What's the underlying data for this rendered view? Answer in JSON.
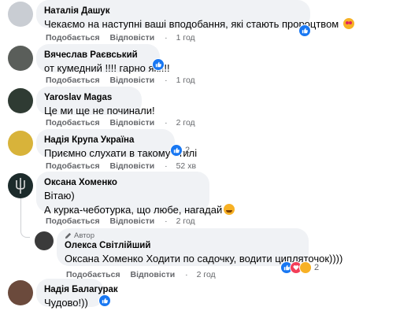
{
  "actions": {
    "like": "Подобається",
    "reply": "Відповісти"
  },
  "comments": [
    {
      "author": "Наталія Дашук",
      "text": "Чекаємо на наступні ваші вподобання, які стають пророцтвом",
      "time": "1 год",
      "avatar_color": "#c9cdd3",
      "avatar_icon": "avatar-icon"
    },
    {
      "author": "Вячеслав Раєвський",
      "text": "от кумедний !!!! гарно як!!!!",
      "time": "1 год",
      "avatar_color": "#5a5e5a",
      "avatar_icon": "avatar-icon"
    },
    {
      "author": "Yaroslav Magas",
      "text": "Це ми ще не починали!",
      "time": "2 год",
      "avatar_color": "#2f3b33",
      "avatar_icon": "avatar-icon"
    },
    {
      "author": "Надія Крупа Україна",
      "text": "Приємно слухати в такому стилі",
      "time": "52 хв",
      "avatar_color": "#d8b33a",
      "avatar_icon": "avatar-icon",
      "reactions_count": "2"
    },
    {
      "author": "Оксана Хоменко",
      "text_line1": "Вітаю)",
      "text_line2": "А курка-чеботурка, що любе, нагадай",
      "time": "2 год",
      "avatar_color": "#1c2b2b",
      "avatar_icon": "trident-icon"
    },
    {
      "badge": "Автор",
      "author": "Олекса Світлійший",
      "mention": "Оксана Хоменко",
      "text": "Ходити по садочку, водити ципляточок))))",
      "time": "2 год",
      "avatar_color": "#3a3a3a",
      "avatar_icon": "avatar-icon",
      "reactions_count": "2"
    },
    {
      "author": "Надія Балагурак",
      "text": "Чудово!))",
      "avatar_color": "#6b4a3c",
      "avatar_icon": "avatar-icon"
    }
  ]
}
